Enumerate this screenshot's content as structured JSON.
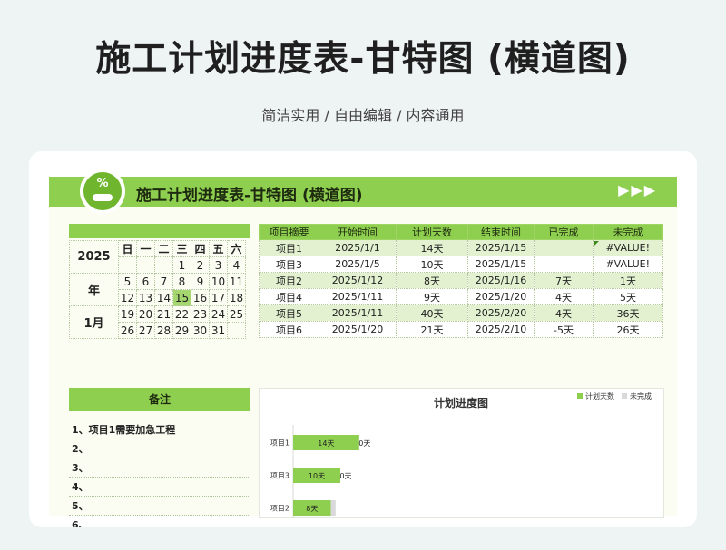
{
  "hero": {
    "title": "施工计划进度表-甘特图 (横道图)",
    "subtitle": "简洁实用 / 自由编辑 / 内容通用"
  },
  "banner": {
    "title": "施工计划进度表-甘特图 (横道图)",
    "badge_icon": "percent-icon",
    "badge_symbol": "%",
    "arrows": "▶▶▶"
  },
  "calendar": {
    "year": "2025",
    "year_label": "年",
    "month": "1月",
    "weekdays": [
      "日",
      "一",
      "二",
      "三",
      "四",
      "五",
      "六"
    ],
    "weeks": [
      [
        "",
        "",
        "",
        "1",
        "2",
        "3",
        "4"
      ],
      [
        "5",
        "6",
        "7",
        "8",
        "9",
        "10",
        "11"
      ],
      [
        "12",
        "13",
        "14",
        "15",
        "16",
        "17",
        "18"
      ],
      [
        "19",
        "20",
        "21",
        "22",
        "23",
        "24",
        "25"
      ],
      [
        "26",
        "27",
        "28",
        "29",
        "30",
        "31",
        ""
      ]
    ],
    "today": "15"
  },
  "schedule": {
    "headers": [
      "项目摘要",
      "开始时间",
      "计划天数",
      "结束时间",
      "已完成",
      "未完成"
    ],
    "rows": [
      [
        "项目1",
        "2025/1/1",
        "14天",
        "2025/1/15",
        "",
        "#VALUE!"
      ],
      [
        "项目3",
        "2025/1/5",
        "10天",
        "2025/1/15",
        "",
        "#VALUE!"
      ],
      [
        "项目2",
        "2025/1/12",
        "8天",
        "2025/1/16",
        "7天",
        "1天"
      ],
      [
        "项目4",
        "2025/1/11",
        "9天",
        "2025/1/20",
        "4天",
        "5天"
      ],
      [
        "项目5",
        "2025/1/11",
        "40天",
        "2025/2/20",
        "4天",
        "36天"
      ],
      [
        "项目6",
        "2025/1/20",
        "21天",
        "2025/2/10",
        "-5天",
        "26天"
      ]
    ]
  },
  "remarks": {
    "title": "备注",
    "items": [
      "1、项目1需要加急工程",
      "2、",
      "3、",
      "4、",
      "5、",
      "6、"
    ]
  },
  "colors": {
    "accent": "#8fcf4f",
    "accent_dark": "#6fb52d",
    "row_tint": "#e3f1d0",
    "bar_remaining": "#d9d9d9"
  },
  "chart_data": {
    "type": "bar",
    "orientation": "horizontal",
    "stacked": true,
    "title": "计划进度图",
    "categories": [
      "项目1",
      "项目3",
      "项目2"
    ],
    "series": [
      {
        "name": "计划天数",
        "values": [
          14,
          10,
          8
        ],
        "labels": [
          "14天",
          "10天",
          "8天"
        ],
        "color": "#8fcf4f"
      },
      {
        "name": "未完成",
        "values": [
          0,
          0,
          1
        ],
        "labels": [
          "0天",
          "0天",
          ""
        ],
        "color": "#d9d9d9"
      }
    ],
    "legend": "top-right"
  }
}
